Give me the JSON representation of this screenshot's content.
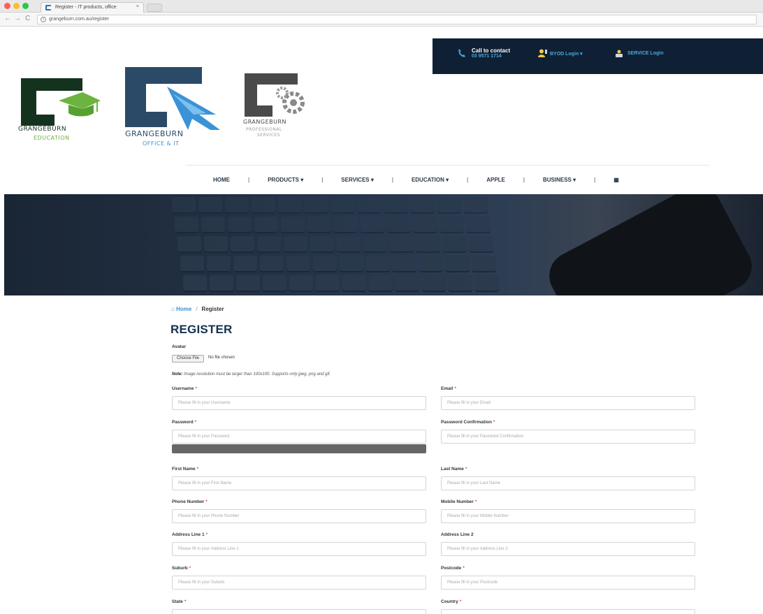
{
  "browser": {
    "tab_title": "Register - IT products, office",
    "tab_close": "×",
    "url": "grangeburn.com.au/register",
    "back": "←",
    "forward": "→",
    "reload": "C",
    "info": "i"
  },
  "header": {
    "contact_title": "Call to contact",
    "contact_phone": "03 9571 1714",
    "login_1": "BYOD Login ▾",
    "login_2": "SERVICE Login",
    "brand_colors": {
      "dark": "#0f2034",
      "accent": "#4aa8e0",
      "green": "#6db33f",
      "navy": "#2b3a4a"
    }
  },
  "logos": [
    {
      "name": "GRANGEBURN",
      "sub": "EDUCATION"
    },
    {
      "name": "GRANGEBURN",
      "sub": "OFFICE & IT"
    },
    {
      "name": "GRANGEBURN",
      "sub": "PROFESSIONAL",
      "sub2": "SERVICES"
    }
  ],
  "nav": {
    "items": [
      "HOME",
      "PRODUCTS ▾",
      "SERVICES ▾",
      "EDUCATION ▾",
      "APPLE",
      "BUSINESS ▾"
    ],
    "separator": "|",
    "grid_icon": "▦"
  },
  "breadcrumb": {
    "home": "Home",
    "separator": "/",
    "current": "Register",
    "home_icon": "⌂"
  },
  "form": {
    "title": "REGISTER",
    "avatar_label": "Avatar",
    "file_button": "Choose File",
    "file_status": "No file chosen",
    "note_bold": "Note:",
    "note_text": " Image resolution must be larger than 100x100. Supports only jpeg, png and gif.",
    "required_mark": "*",
    "fields": {
      "username": {
        "label": "Username",
        "placeholder": "Please fill in your Username"
      },
      "email": {
        "label": "Email",
        "placeholder": "Please fill in your Email"
      },
      "password": {
        "label": "Password",
        "placeholder": "Please fill in your Password"
      },
      "password_confirmation": {
        "label": "Password Confirmation",
        "placeholder": "Please fill in your Password Confirmation"
      },
      "first_name": {
        "label": "First Name",
        "placeholder": "Please fill in your First Name"
      },
      "last_name": {
        "label": "Last Name",
        "placeholder": "Please fill in your Last Name"
      },
      "phone_number": {
        "label": "Phone Number",
        "placeholder": "Please fill in your Phone Number"
      },
      "mobile_number": {
        "label": "Mobile Number",
        "placeholder": "Please fill in your Mobile Number"
      },
      "address_1": {
        "label": "Address Line 1",
        "placeholder": "Please fill in your Address Line 1"
      },
      "address_2": {
        "label": "Address Line 2",
        "placeholder": "Please fill in your Address Line 2"
      },
      "suburb": {
        "label": "Suburb",
        "placeholder": "Please fill in your Suburb"
      },
      "postcode": {
        "label": "Postcode",
        "placeholder": "Please fill in your Postcode"
      },
      "state": {
        "label": "State"
      },
      "country": {
        "label": "Country"
      }
    }
  }
}
